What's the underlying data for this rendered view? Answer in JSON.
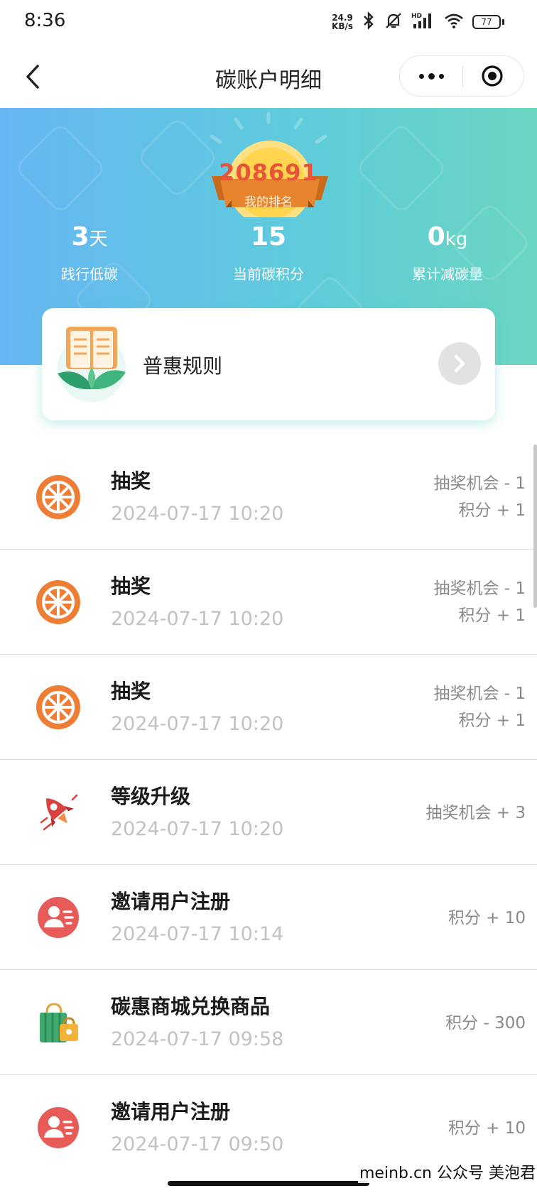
{
  "status_bar": {
    "time": "8:36",
    "net_speed_value": "24.9",
    "net_speed_unit": "KB/s",
    "battery": "77",
    "icons": [
      "bluetooth-icon",
      "mute-bell-icon",
      "hd-signal-icon",
      "wifi-icon",
      "battery-icon"
    ]
  },
  "nav": {
    "title": "碳账户明细",
    "icons": [
      "back-arrow-icon",
      "more-dots-icon",
      "close-target-icon"
    ]
  },
  "colors": {
    "header_gradient_start": "#66b6f3",
    "header_gradient_end": "#6ad6c1",
    "rank_number": "#e9533a",
    "ribbon": "#e8832e",
    "accent_orange": "#ee7e35",
    "accent_red": "#e65a58"
  },
  "rank": {
    "number": "208691",
    "label": "我的排名"
  },
  "stats": [
    {
      "value": "3",
      "unit": "天",
      "label": "践行低碳"
    },
    {
      "value": "15",
      "unit": "",
      "label": "当前碳积分"
    },
    {
      "value": "0",
      "unit": "kg",
      "label": "累计减碳量"
    }
  ],
  "rules": {
    "label": "普惠规则",
    "icon": "book-leaf-icon"
  },
  "records": [
    {
      "title": "抽奖",
      "time": "2024-07-17 10:20",
      "lines": [
        "抽奖机会 - 1",
        "积分 + 1"
      ],
      "icon": "wheel-icon"
    },
    {
      "title": "抽奖",
      "time": "2024-07-17 10:20",
      "lines": [
        "抽奖机会 - 1",
        "积分 + 1"
      ],
      "icon": "wheel-icon"
    },
    {
      "title": "抽奖",
      "time": "2024-07-17 10:20",
      "lines": [
        "抽奖机会 - 1",
        "积分 + 1"
      ],
      "icon": "wheel-icon"
    },
    {
      "title": "等级升级",
      "time": "2024-07-17 10:20",
      "lines": [
        "抽奖机会 + 3"
      ],
      "icon": "rocket-icon"
    },
    {
      "title": "邀请用户注册",
      "time": "2024-07-17 10:14",
      "lines": [
        "积分 + 10"
      ],
      "icon": "user-card-icon"
    },
    {
      "title": "碳惠商城兑换商品",
      "time": "2024-07-17 09:58",
      "lines": [
        "积分 - 300"
      ],
      "icon": "shopping-bag-icon"
    },
    {
      "title": "邀请用户注册",
      "time": "2024-07-17 09:50",
      "lines": [
        "积分 + 10"
      ],
      "icon": "user-card-icon"
    }
  ],
  "watermark": "meinb.cn  公众号 美泡君"
}
